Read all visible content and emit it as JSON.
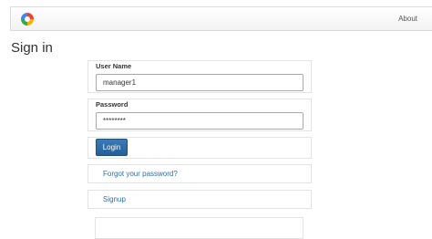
{
  "navbar": {
    "about_label": "About"
  },
  "page": {
    "title": "Sign in"
  },
  "form": {
    "username_label": "User Name",
    "username_value": "manager1",
    "password_label": "Password",
    "password_value": "********",
    "login_label": "Login",
    "forgot_label": "Forgot your password?",
    "signup_label": "Signup"
  },
  "colors": {
    "primary": "#2e6da4",
    "link": "#2f6fae"
  },
  "icons": {
    "logo": "app-logo-icon"
  }
}
